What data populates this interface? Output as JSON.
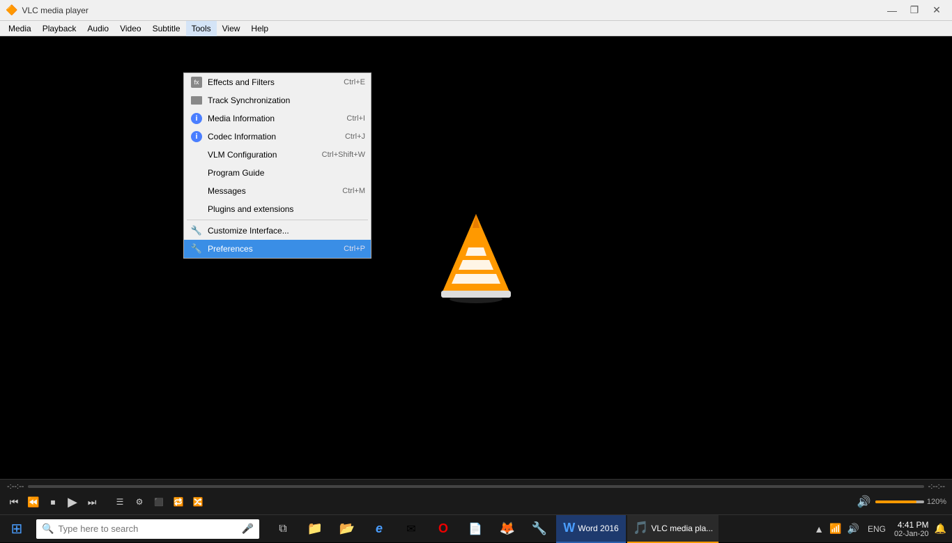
{
  "app": {
    "title": "VLC media player",
    "icon": "▶"
  },
  "titlebar": {
    "minimize": "—",
    "maximize": "❐",
    "close": "✕"
  },
  "menubar": {
    "items": [
      {
        "id": "media",
        "label": "Media"
      },
      {
        "id": "playback",
        "label": "Playback"
      },
      {
        "id": "audio",
        "label": "Audio"
      },
      {
        "id": "video",
        "label": "Video"
      },
      {
        "id": "subtitle",
        "label": "Subtitle"
      },
      {
        "id": "tools",
        "label": "Tools"
      },
      {
        "id": "view",
        "label": "View"
      },
      {
        "id": "help",
        "label": "Help"
      }
    ]
  },
  "tools_menu": {
    "items": [
      {
        "id": "effects",
        "label": "Effects and Filters",
        "shortcut": "Ctrl+E",
        "icon": "fx"
      },
      {
        "id": "track_sync",
        "label": "Track Synchronization",
        "shortcut": "",
        "icon": "track"
      },
      {
        "id": "media_info",
        "label": "Media Information",
        "shortcut": "Ctrl+I",
        "icon": "info"
      },
      {
        "id": "codec_info",
        "label": "Codec Information",
        "shortcut": "Ctrl+J",
        "icon": "info"
      },
      {
        "id": "vlm",
        "label": "VLM Configuration",
        "shortcut": "Ctrl+Shift+W",
        "icon": ""
      },
      {
        "id": "program_guide",
        "label": "Program Guide",
        "shortcut": "",
        "icon": ""
      },
      {
        "id": "messages",
        "label": "Messages",
        "shortcut": "Ctrl+M",
        "icon": ""
      },
      {
        "id": "plugins",
        "label": "Plugins and extensions",
        "shortcut": "",
        "icon": ""
      },
      {
        "id": "customize",
        "label": "Customize Interface...",
        "shortcut": "",
        "icon": "wrench"
      },
      {
        "id": "preferences",
        "label": "Preferences",
        "shortcut": "Ctrl+P",
        "icon": "wrench"
      }
    ],
    "separators_after": [
      1,
      7,
      8
    ]
  },
  "controls": {
    "time_current": "-:--:--",
    "time_total": "-:--:--",
    "volume_pct": "120%"
  },
  "taskbar": {
    "search_placeholder": "Type here to search",
    "apps": [
      {
        "id": "task-view",
        "icon": "⧉",
        "label": "Task View"
      },
      {
        "id": "edge",
        "icon": "e",
        "label": "Microsoft Edge"
      },
      {
        "id": "file-explorer",
        "icon": "📁",
        "label": "File Explorer"
      },
      {
        "id": "videos",
        "icon": "📂",
        "label": "videos"
      },
      {
        "id": "edge2",
        "icon": "🌐",
        "label": "Edge"
      },
      {
        "id": "mail",
        "icon": "✉",
        "label": "Mail"
      },
      {
        "id": "opera",
        "icon": "O",
        "label": "Opera"
      },
      {
        "id": "file2",
        "icon": "📄",
        "label": "File"
      },
      {
        "id": "firefox",
        "icon": "🦊",
        "label": "Firefox"
      },
      {
        "id": "repair",
        "icon": "🔧",
        "label": "Repair Corru..."
      },
      {
        "id": "word",
        "icon": "W",
        "label": "Word 2016"
      },
      {
        "id": "vlc",
        "icon": "🎵",
        "label": "VLC media pla..."
      }
    ],
    "tray": {
      "lang": "ENG",
      "time": "4:41 PM",
      "date": "02-Jan-20"
    }
  }
}
